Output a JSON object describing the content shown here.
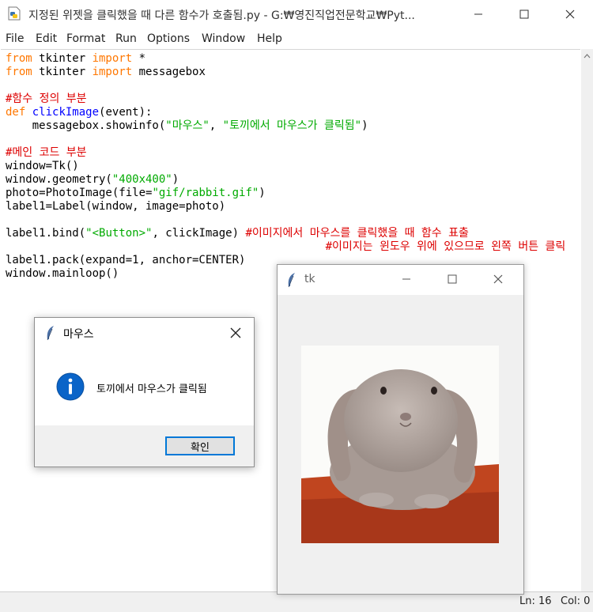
{
  "idle_window": {
    "title": "지정된 위젯을 클릭했을 때 다른 함수가 호출됨.py - G:₩영진직업전문학교₩Pyt...",
    "app_icon": "python-file-icon",
    "controls": {
      "minimize": "minimize-icon",
      "maximize": "maximize-icon",
      "close": "close-icon"
    }
  },
  "menu": [
    "File",
    "Edit",
    "Format",
    "Run",
    "Options",
    "Window",
    "Help"
  ],
  "code_lines": [
    [
      {
        "t": "from",
        "c": "kw"
      },
      {
        "t": " tkinter ",
        "c": ""
      },
      {
        "t": "import",
        "c": "kw"
      },
      {
        "t": " *",
        "c": ""
      }
    ],
    [
      {
        "t": "from",
        "c": "kw"
      },
      {
        "t": " tkinter ",
        "c": ""
      },
      {
        "t": "import",
        "c": "kw"
      },
      {
        "t": " messagebox",
        "c": ""
      }
    ],
    [],
    [
      {
        "t": "#함수 정의 부분",
        "c": "cm"
      }
    ],
    [
      {
        "t": "def",
        "c": "kw"
      },
      {
        "t": " ",
        "c": ""
      },
      {
        "t": "clickImage",
        "c": "df"
      },
      {
        "t": "(event):",
        "c": ""
      }
    ],
    [
      {
        "t": "    messagebox.showinfo(",
        "c": ""
      },
      {
        "t": "\"마우스\"",
        "c": "st"
      },
      {
        "t": ", ",
        "c": ""
      },
      {
        "t": "\"토끼에서 마우스가 클릭됨\"",
        "c": "st"
      },
      {
        "t": ")",
        "c": ""
      }
    ],
    [],
    [
      {
        "t": "#메인 코드 부분",
        "c": "cm"
      }
    ],
    [
      {
        "t": "window=Tk()",
        "c": ""
      }
    ],
    [
      {
        "t": "window.geometry(",
        "c": ""
      },
      {
        "t": "\"400x400\"",
        "c": "st"
      },
      {
        "t": ")",
        "c": ""
      }
    ],
    [
      {
        "t": "photo=PhotoImage(file=",
        "c": ""
      },
      {
        "t": "\"gif/rabbit.gif\"",
        "c": "st"
      },
      {
        "t": ")",
        "c": ""
      }
    ],
    [
      {
        "t": "label1=Label(window, image=photo)",
        "c": ""
      }
    ],
    [],
    [
      {
        "t": "label1.bind(",
        "c": ""
      },
      {
        "t": "\"<Button>\"",
        "c": "st"
      },
      {
        "t": ", clickImage) ",
        "c": ""
      },
      {
        "t": "#이미지에서 마우스를 클릭했을 때 함수 표출",
        "c": "cm"
      }
    ],
    [
      {
        "t": "                                                ",
        "c": ""
      },
      {
        "t": "#이미지는 윈도우 위에 있으므로 왼쪽 버튼 클릭",
        "c": "cm"
      }
    ],
    [
      {
        "t": "label1.pack(expand=1, anchor=CENTER)",
        "c": ""
      }
    ],
    [
      {
        "t": "window.mainloop()",
        "c": ""
      }
    ]
  ],
  "status": {
    "line": "Ln: 16",
    "col": "Col: 0"
  },
  "tk_window": {
    "title": "tk",
    "icon": "feather-icon",
    "image_alt": "rabbit photo"
  },
  "messagebox": {
    "title": "마우스",
    "icon": "info-icon",
    "message": "토끼에서 마우스가 클릭됨",
    "ok_label": "확인"
  },
  "colors": {
    "keyword": "#ff7700",
    "comment": "#dd0000",
    "string": "#00aa00",
    "def_name": "#0000ff",
    "focus_border": "#0078d7",
    "info_blue": "#0a64c8"
  }
}
